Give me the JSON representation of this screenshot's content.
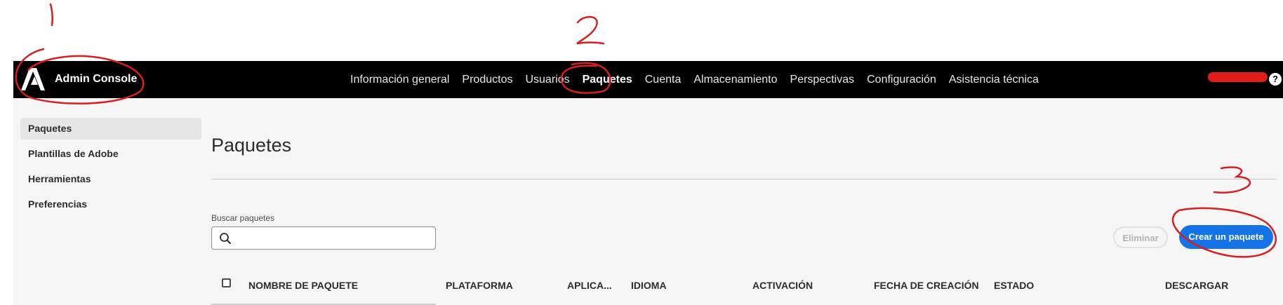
{
  "header": {
    "app_title": "Admin Console",
    "nav": [
      {
        "label": "Información general",
        "active": false
      },
      {
        "label": "Productos",
        "active": false
      },
      {
        "label": "Usuarios",
        "active": false
      },
      {
        "label": "Paquetes",
        "active": true
      },
      {
        "label": "Cuenta",
        "active": false
      },
      {
        "label": "Almacenamiento",
        "active": false
      },
      {
        "label": "Perspectivas",
        "active": false
      },
      {
        "label": "Configuración",
        "active": false
      },
      {
        "label": "Asistencia técnica",
        "active": false
      }
    ],
    "help_icon": "?"
  },
  "sidebar": {
    "items": [
      {
        "label": "Paquetes",
        "active": true
      },
      {
        "label": "Plantillas de Adobe",
        "active": false
      },
      {
        "label": "Herramientas",
        "active": false
      },
      {
        "label": "Preferencias",
        "active": false
      }
    ]
  },
  "main": {
    "title": "Paquetes",
    "search_label": "Buscar paquetes",
    "search_value": "",
    "delete_label": "Eliminar",
    "create_label": "Crear un paquete",
    "columns": [
      "NOMBRE DE PAQUETE",
      "PLATAFORMA",
      "APLICA...",
      "IDIOMA",
      "ACTIVACIÓN",
      "FECHA DE CREACIÓN",
      "ESTADO",
      "DESCARGAR"
    ]
  },
  "annotations": [
    "1",
    "2",
    "3"
  ],
  "colors": {
    "accent": "#1473e6",
    "annotation": "#d61f1f",
    "topbar": "#000000"
  }
}
